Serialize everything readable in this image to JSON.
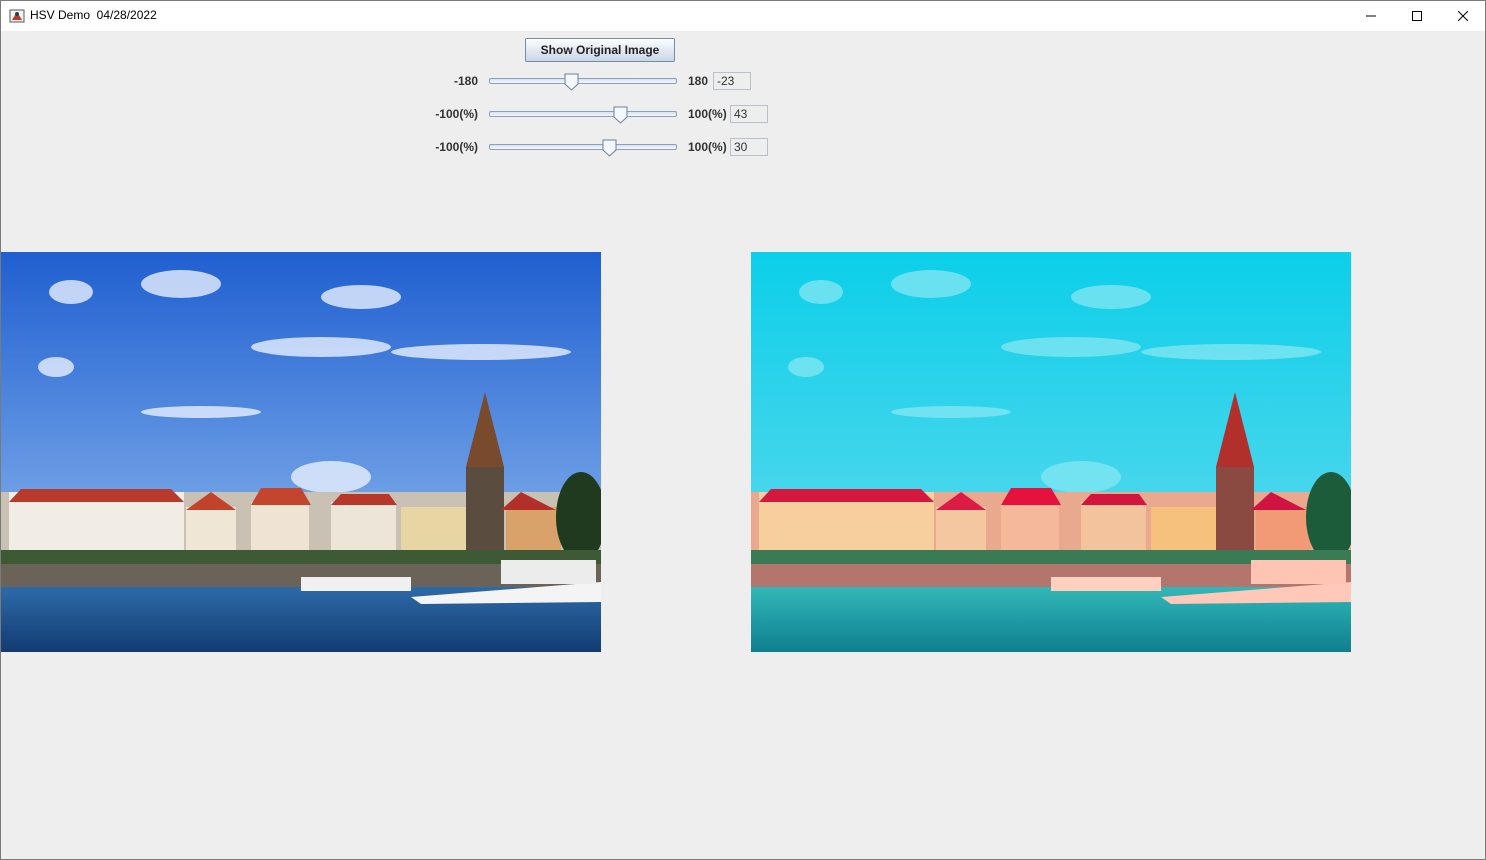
{
  "window": {
    "title": "HSV Demo  04/28/2022",
    "icon": "java-app-icon",
    "controls": [
      "minimize-icon",
      "maximize-icon",
      "close-icon"
    ]
  },
  "toolbar": {
    "show_original_label": "Show Original Image"
  },
  "sliders": [
    {
      "name": "hue",
      "min_label": "-180",
      "max_label": "180",
      "min": -180,
      "max": 180,
      "value": -23,
      "value_text": "-23"
    },
    {
      "name": "saturation",
      "min_label": "-100(%)",
      "max_label": "100(%)",
      "min": -100,
      "max": 100,
      "value": 43,
      "value_text": "43"
    },
    {
      "name": "value",
      "min_label": "-100(%)",
      "max_label": "100(%)",
      "min": -100,
      "max": 100,
      "value": 30,
      "value_text": "30"
    }
  ],
  "images": {
    "original": {
      "kind": "harbor-town-photo",
      "sky_color": "#2f6fd6",
      "water_color": "#1d4f8c"
    },
    "adjusted": {
      "kind": "harbor-town-photo-hsv-adjusted",
      "sky_color": "#12d2ea",
      "water_color": "#1aa5a8"
    }
  },
  "colors": {
    "window_bg": "#eeeeee",
    "titlebar_bg": "#ffffff",
    "slider_track": "#8aa0bd"
  }
}
